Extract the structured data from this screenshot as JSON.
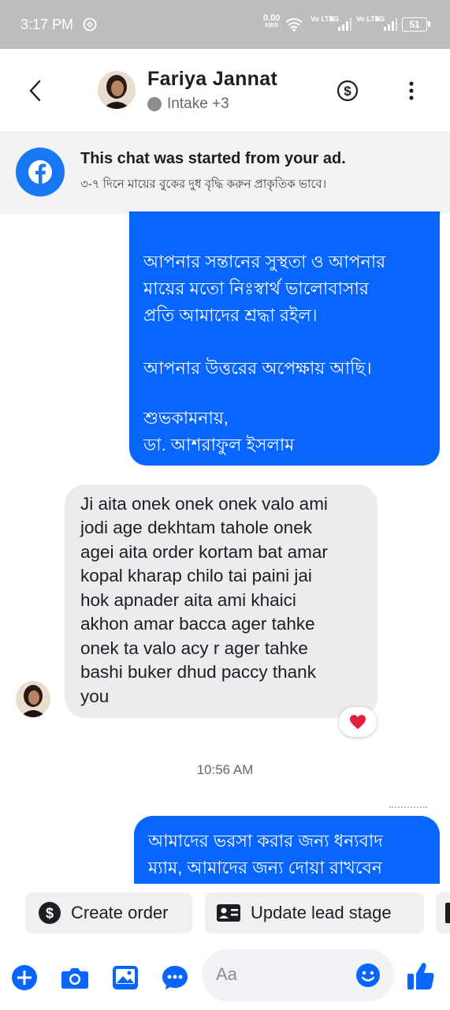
{
  "status_bar": {
    "time": "3:17 PM",
    "net_speed": "0.00",
    "net_unit": "KB/S",
    "sim1": "Vo LTE",
    "sim1_net": "4G",
    "sim2": "Vo LTE",
    "sim2_net": "4G",
    "battery": "51"
  },
  "header": {
    "contact_name": "Fariya Jannat",
    "subtitle": "Intake +3",
    "icons": [
      "back-arrow-icon",
      "dollar-icon",
      "more-vert-icon"
    ]
  },
  "ad_banner": {
    "title": "This chat was started from your ad.",
    "ad_text": "৩-৭ দিনে মায়ের বুকের দুধ বৃদ্ধি করুন প্রাকৃতিক ভাবে।"
  },
  "messages": {
    "outgoing_1": {
      "lines": [
        "আপনার সন্তানের সুস্থতা ও আপনার",
        "মায়ের মতো নিঃস্বার্থ ভালোবাসার",
        "প্রতি আমাদের শ্রদ্ধা রইল।",
        "আপনার উত্তরের অপেক্ষায় আছি।",
        "শুভকামনায়,",
        "ডা. আশরাফুল ইসলাম"
      ]
    },
    "incoming_1": {
      "lines": [
        "Ji aita onek onek onek  valo ami",
        "jodi age dekhtam  tahole onek",
        "agei aita order kortam bat amar",
        "kopal kharap chilo tai paini jai",
        "hok  apnader aita ami khaici",
        "akhon amar bacca ager tahke",
        "onek ta valo acy r ager tahke",
        "bashi buker dhud paccy thank",
        "you"
      ],
      "reaction": "❤"
    },
    "timestamp": "10:56 AM",
    "outgoing_2": {
      "lines": [
        "আমাদের ভরসা করার জন্য ধন্যবাদ",
        "ম্যাম, আমাদের জন্য দোয়া রাখবেন"
      ]
    }
  },
  "quick_actions": {
    "create_order": "Create order",
    "update_lead_stage": "Update lead stage"
  },
  "composer": {
    "placeholder": "Aa"
  },
  "colors": {
    "messenger_blue": "#0866ff",
    "incoming_bubble": "#ececef",
    "status_bar": "#bdbdbd",
    "heart": "#e41e3f"
  }
}
